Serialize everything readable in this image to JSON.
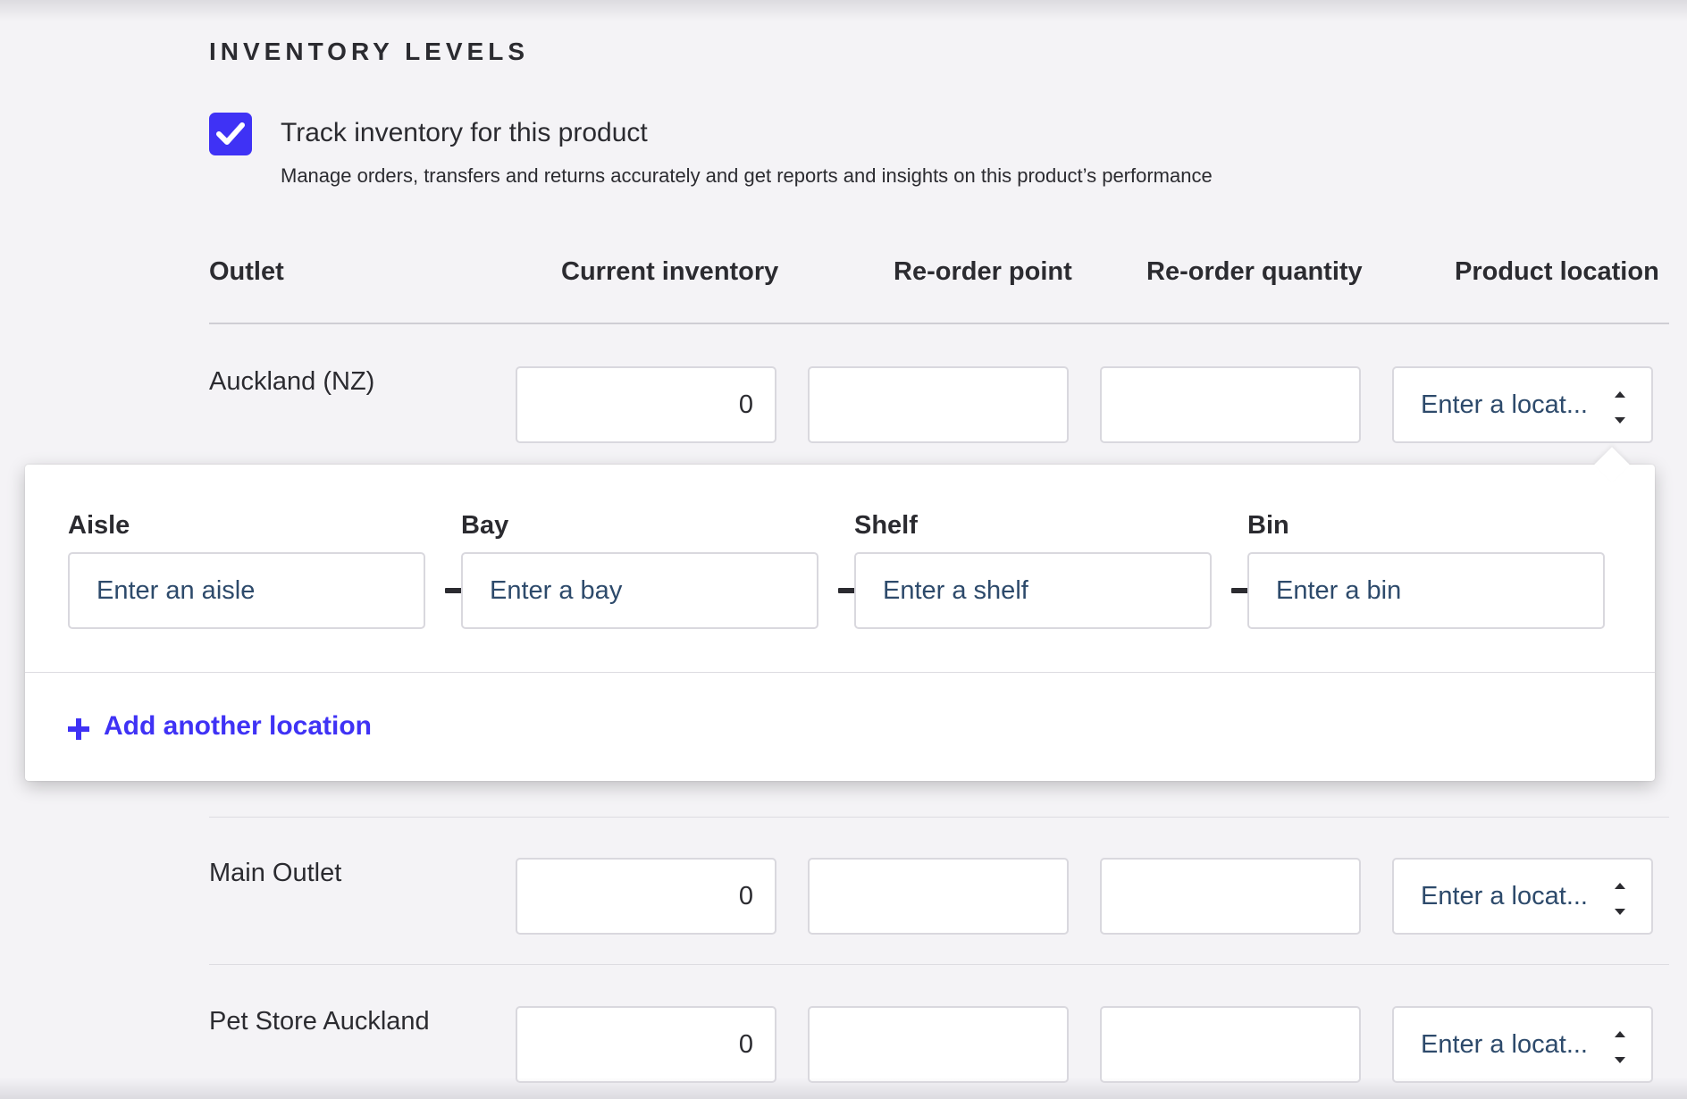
{
  "section": {
    "title": "INVENTORY LEVELS",
    "track_label": "Track inventory for this product",
    "track_help": "Manage orders, transfers and returns accurately and get reports and insights on this product’s performance"
  },
  "table": {
    "headers": [
      "Outlet",
      "Current inventory",
      "Re-order point",
      "Re-order quantity",
      "Product location"
    ],
    "location_placeholder": "Enter a locat...",
    "rows": [
      {
        "outlet": "Auckland (NZ)",
        "current": "0",
        "reorder_point": "",
        "reorder_qty": ""
      },
      {
        "outlet": "Main Outlet",
        "current": "0",
        "reorder_point": "",
        "reorder_qty": ""
      },
      {
        "outlet": "Pet Store Auckland",
        "current": "0",
        "reorder_point": "",
        "reorder_qty": ""
      }
    ]
  },
  "popover": {
    "fields": [
      {
        "label": "Aisle",
        "placeholder": "Enter an aisle"
      },
      {
        "label": "Bay",
        "placeholder": "Enter a bay"
      },
      {
        "label": "Shelf",
        "placeholder": "Enter a shelf"
      },
      {
        "label": "Bin",
        "placeholder": "Enter a bin"
      }
    ],
    "add_label": "Add another location"
  },
  "colors": {
    "accent": "#3f32f5",
    "placeholder": "#2d4a6b",
    "text": "#2b2b30",
    "background": "#f4f3f6"
  }
}
